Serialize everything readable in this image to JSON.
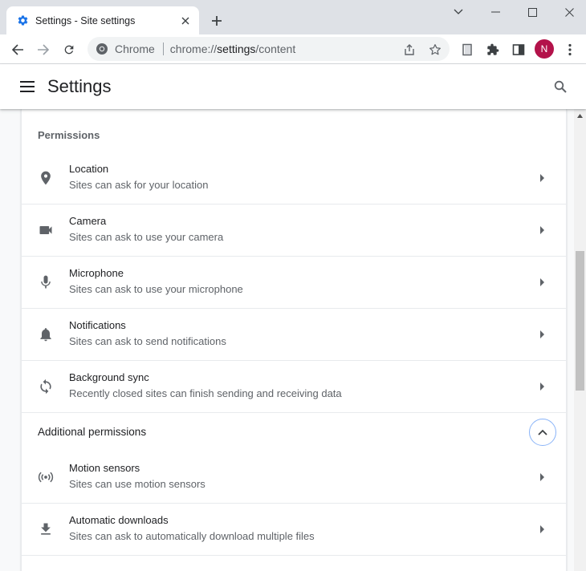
{
  "tab": {
    "title": "Settings - Site settings",
    "favicon": "gear-icon",
    "close_icon": "close-icon"
  },
  "window_controls": [
    "chevron-down-icon",
    "minimize-icon",
    "maximize-icon",
    "close-icon"
  ],
  "toolbar": {
    "chip": "Chrome",
    "url_scheme": "chrome://",
    "url_host": "settings",
    "url_path": "/content"
  },
  "profile": {
    "initial": "N",
    "color": "#b3124a"
  },
  "header": {
    "title": "Settings"
  },
  "permissions": {
    "heading": "Permissions",
    "items": [
      {
        "icon": "location-pin-icon",
        "title": "Location",
        "subtitle": "Sites can ask for your location"
      },
      {
        "icon": "camera-icon",
        "title": "Camera",
        "subtitle": "Sites can ask to use your camera"
      },
      {
        "icon": "microphone-icon",
        "title": "Microphone",
        "subtitle": "Sites can ask to use your microphone"
      },
      {
        "icon": "bell-icon",
        "title": "Notifications",
        "subtitle": "Sites can ask to send notifications"
      },
      {
        "icon": "sync-icon",
        "title": "Background sync",
        "subtitle": "Recently closed sites can finish sending and receiving data"
      }
    ]
  },
  "additional": {
    "heading": "Additional permissions",
    "items": [
      {
        "icon": "motion-sensor-icon",
        "title": "Motion sensors",
        "subtitle": "Sites can use motion sensors"
      },
      {
        "icon": "download-icon",
        "title": "Automatic downloads",
        "subtitle": "Sites can ask to automatically download multiple files"
      }
    ]
  },
  "colors": {
    "accent": "#1a73e8",
    "tabstrip": "#dee1e6",
    "collapse_ring": "#8ab4f8"
  }
}
